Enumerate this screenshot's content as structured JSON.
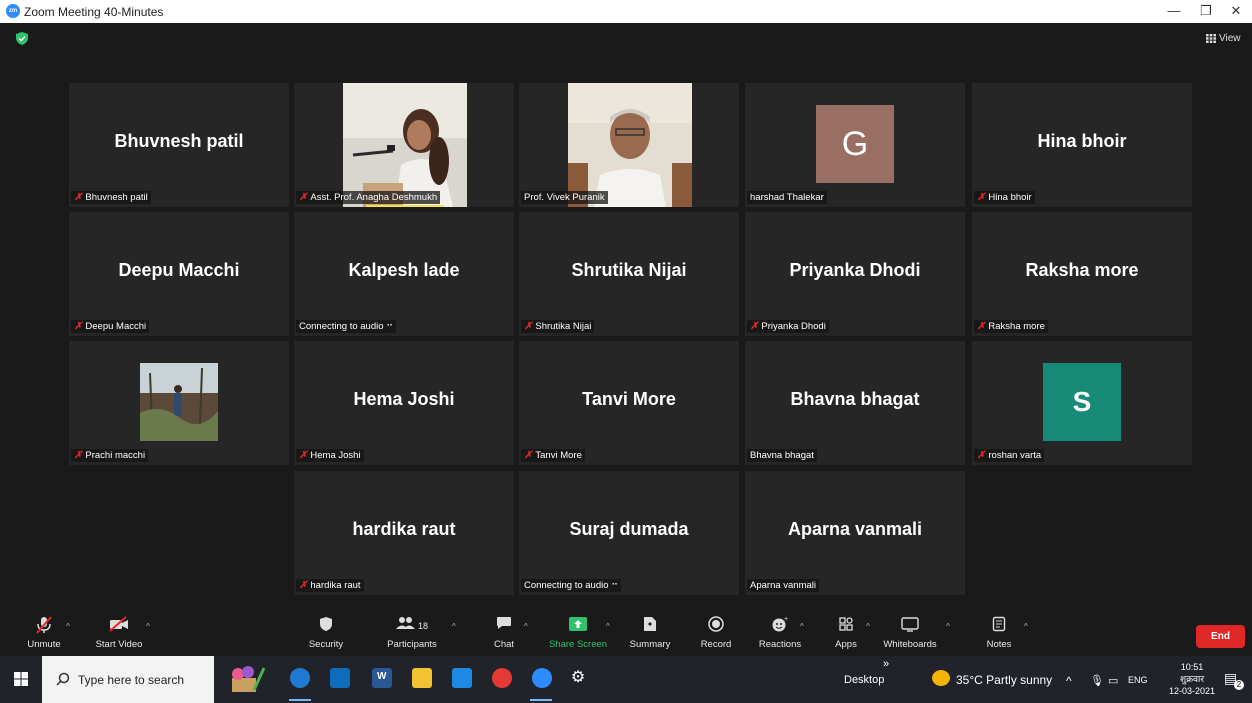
{
  "window": {
    "title": "Zoom Meeting 40-Minutes",
    "app_icon_text": "zm",
    "minimize": "—",
    "maximize": "❐",
    "close": "✕"
  },
  "meeting": {
    "view_label": "View",
    "tiles": [
      {
        "big": "Bhuvnesh patil",
        "label": "Bhuvnesh patil",
        "muted": true,
        "kind": "name"
      },
      {
        "big": "",
        "label": "Asst. Prof. Anagha Deshmukh",
        "muted": true,
        "kind": "photo-speaker"
      },
      {
        "big": "",
        "label": "Prof. Vivek Puranik",
        "muted": false,
        "kind": "photo-man"
      },
      {
        "big": "",
        "label": "harshad Thalekar",
        "muted": false,
        "kind": "avatar",
        "avatar_letter": "G",
        "avatar_color": "#9a6f63"
      },
      {
        "big": "Hina bhoir",
        "label": "Hina bhoir",
        "muted": true,
        "kind": "name"
      },
      {
        "big": "Deepu Macchi",
        "label": "Deepu Macchi",
        "muted": true,
        "kind": "name"
      },
      {
        "big": "Kalpesh lade",
        "label": "Connecting to audio ⠒",
        "muted": false,
        "kind": "name"
      },
      {
        "big": "Shrutika Nijai",
        "label": "Shrutika Nijai",
        "muted": true,
        "kind": "name"
      },
      {
        "big": "Priyanka Dhodi",
        "label": "Priyanka Dhodi",
        "muted": true,
        "kind": "name"
      },
      {
        "big": "Raksha more",
        "label": "Raksha more",
        "muted": true,
        "kind": "name"
      },
      {
        "big": "",
        "label": "Prachi macchi",
        "muted": true,
        "kind": "photo-field"
      },
      {
        "big": "Hema Joshi",
        "label": "Hema Joshi",
        "muted": true,
        "kind": "name"
      },
      {
        "big": "Tanvi More",
        "label": "Tanvi More",
        "muted": true,
        "kind": "name"
      },
      {
        "big": "Bhavna bhagat",
        "label": "Bhavna bhagat",
        "muted": false,
        "kind": "name"
      },
      {
        "big": "",
        "label": "roshan varta",
        "muted": true,
        "kind": "avatar",
        "avatar_letter": "S",
        "avatar_color": "#178a78"
      },
      {
        "big": "hardika raut",
        "label": "hardika raut",
        "muted": true,
        "kind": "name"
      },
      {
        "big": "Suraj dumada",
        "label": "Connecting to audio ⠒",
        "muted": false,
        "kind": "name"
      },
      {
        "big": "Aparna vanmali",
        "label": "Aparna vanmali",
        "muted": false,
        "kind": "name"
      }
    ]
  },
  "toolbar": {
    "unmute": "Unmute",
    "start_video": "Start Video",
    "security": "Security",
    "participants": "Participants",
    "participants_count": "18",
    "chat": "Chat",
    "share_screen": "Share Screen",
    "summary": "Summary",
    "record": "Record",
    "reactions": "Reactions",
    "apps": "Apps",
    "whiteboards": "Whiteboards",
    "notes": "Notes",
    "end": "End",
    "share_color": "#2dc26b",
    "end_color": "#e02828"
  },
  "taskbar": {
    "search_placeholder": "Type here to search",
    "desktop": "Desktop",
    "weather": "35°C  Partly sunny",
    "lang": "ENG",
    "time": "10:51",
    "day": "शुक्रवार",
    "date": "12-03-2021",
    "notif_count": "2",
    "chevron": "»"
  }
}
